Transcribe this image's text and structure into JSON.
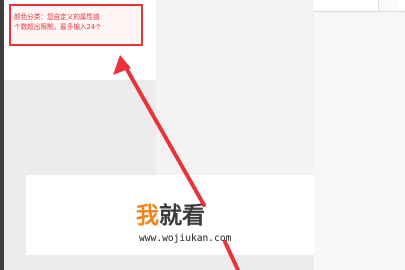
{
  "tooltip": {
    "line1": "颜色分类：您自定义的属性值",
    "line2": "个数超出限制，最多输入24个"
  },
  "watermark": {
    "logo_char_1": "我",
    "logo_rest": "就看",
    "url": "www.wojiukan.com"
  },
  "colors": {
    "accent_red": "#e8333a",
    "logo_orange": "#f0851e",
    "panel_bg": "#ffffff",
    "page_bg": "#ececee"
  }
}
